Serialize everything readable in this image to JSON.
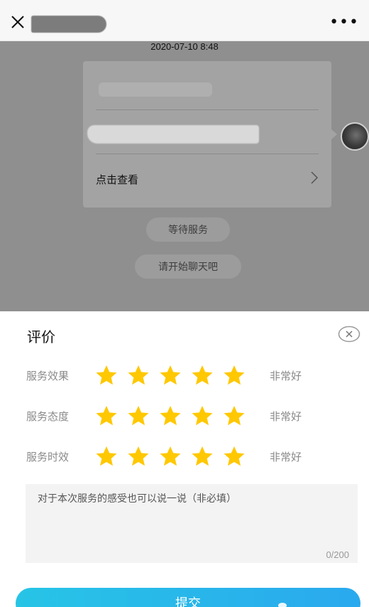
{
  "header": {
    "close_icon": "close-icon",
    "more_icon": "more-dots-icon",
    "more_text": "•••"
  },
  "chat": {
    "timestamp": "2020-07-10 8:48",
    "card_link_label": "点击查看",
    "status_pill": "等待服务",
    "start_chat_pill": "请开始聊天吧"
  },
  "rating": {
    "title": "评价",
    "rows": [
      {
        "label": "服务效果",
        "stars": 5,
        "max_stars": 5,
        "level": "非常好"
      },
      {
        "label": "服务态度",
        "stars": 5,
        "max_stars": 5,
        "level": "非常好"
      },
      {
        "label": "服务时效",
        "stars": 5,
        "max_stars": 5,
        "level": "非常好"
      }
    ],
    "comment_placeholder": "对于本次服务的感受也可以说一说（非必填）",
    "counter": "0/200",
    "submit_label": "提交"
  },
  "colors": {
    "star": "#ffc800",
    "submit_start": "#27c4e6",
    "submit_end": "#2aa9ee",
    "overlay": "#8f8f8f"
  }
}
